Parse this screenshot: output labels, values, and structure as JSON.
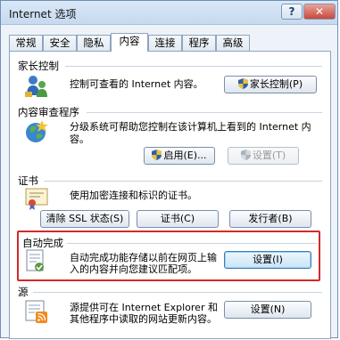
{
  "window": {
    "title": "Internet 选项",
    "help_label": "?",
    "close_label": "✕"
  },
  "tabs": [
    {
      "label": "常规"
    },
    {
      "label": "安全"
    },
    {
      "label": "隐私"
    },
    {
      "label": "内容",
      "active": true
    },
    {
      "label": "连接"
    },
    {
      "label": "程序"
    },
    {
      "label": "高级"
    }
  ],
  "sections": {
    "parental": {
      "title": "家长控制",
      "description": "控制可查看的 Internet 内容。",
      "button_label": "家长控制(P)"
    },
    "content_advisor": {
      "title": "内容审查程序",
      "description_line1": "分级系统可帮助您控制在该计算机上看到的 Internet 内",
      "description_line2": "容。",
      "enable_label": "启用(E)...",
      "settings_label": "设置(T)"
    },
    "certificates": {
      "title": "证书",
      "description": "使用加密连接和标识的证书。",
      "clear_ssl_label": "清除 SSL 状态(S)",
      "certificates_label": "证书(C)",
      "publishers_label": "发行者(B)"
    },
    "autocomplete": {
      "title": "自动完成",
      "description_line1": "自动完成功能存储以前在网页上输",
      "description_line2": "入的内容并向您建议匹配项。",
      "settings_label": "设置(I)"
    },
    "feeds": {
      "title": "源",
      "description_line1": "源提供可在 Internet Explorer 和",
      "description_line2": "其他程序中读取的网站更新内容。",
      "settings_label": "设置(N)"
    }
  }
}
